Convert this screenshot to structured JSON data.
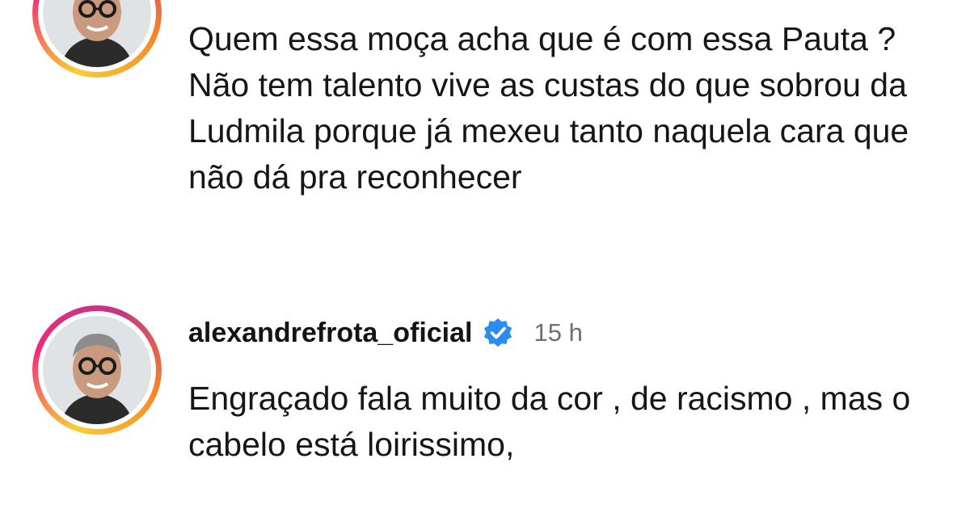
{
  "comments": [
    {
      "avatar": "profile-photo-man-glasses",
      "text": "Quem essa moça acha que é com essa Pauta ? Não tem talento vive as custas do que sobrou da Ludmila porque já mexeu tanto naquela cara que não dá pra reconhecer"
    },
    {
      "avatar": "profile-photo-man-glasses",
      "username": "alexandrefrota_oficial",
      "verified_icon": "verified-badge-icon",
      "time": "15 h",
      "text": "Engraçado fala muito da cor , de racismo , mas o cabelo está loirissimo,"
    }
  ],
  "colors": {
    "verified": "#2d8cf0",
    "timestamp": "#6e6e6e",
    "text": "#161616"
  }
}
